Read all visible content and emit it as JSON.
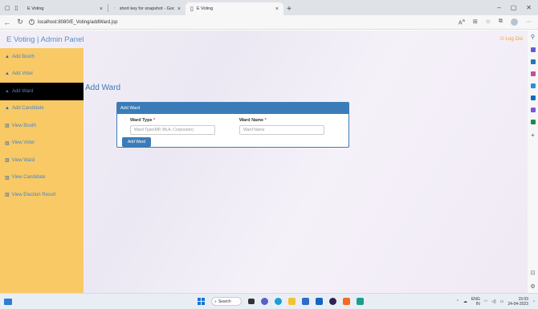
{
  "browser": {
    "tabs": [
      {
        "title": "E Voting",
        "active": false
      },
      {
        "title": "short key for snapshot - Google",
        "active": false
      },
      {
        "title": "E Voting",
        "active": true
      }
    ],
    "url": "localhost:8080/E_Voting/addWard.jsp"
  },
  "header": {
    "brand": "E Voting | Admin Panel",
    "logout_label": "Log Out"
  },
  "sidebar": {
    "items": [
      {
        "label": "Add Booth",
        "icon": "home-icon",
        "active": false
      },
      {
        "label": "Add Voter",
        "icon": "home-icon",
        "active": false
      },
      {
        "label": "Add Ward",
        "icon": "home-icon",
        "active": true
      },
      {
        "label": "Add Candidate",
        "icon": "home-icon",
        "active": false
      },
      {
        "label": "View Booth",
        "icon": "bar-chart-icon",
        "active": false
      },
      {
        "label": "View Voter",
        "icon": "bar-chart-icon",
        "active": false
      },
      {
        "label": "View Ward",
        "icon": "bar-chart-icon",
        "active": false
      },
      {
        "label": "View Candidate",
        "icon": "bar-chart-icon",
        "active": false
      },
      {
        "label": "View Election Result",
        "icon": "bar-chart-icon",
        "active": false
      }
    ]
  },
  "main": {
    "title": "Add Ward",
    "card_title": "Add Ward",
    "form": {
      "ward_type_label": "Ward Type",
      "ward_type_placeholder": "Ward Type(MP, MLA, Corporator)",
      "ward_name_label": "Ward Name",
      "ward_name_placeholder": "Ward Name",
      "required_mark": "*",
      "submit_label": "Add Ward"
    }
  },
  "taskbar": {
    "search_label": "Search",
    "lang_top": "ENG",
    "lang_bottom": "IN",
    "time": "15:03",
    "date": "24-04-2023"
  },
  "colors": {
    "accent": "#3b7cb8",
    "sidebar_bg": "#f8c965",
    "active_item_bg": "#000000",
    "logout": "#f0a020"
  }
}
